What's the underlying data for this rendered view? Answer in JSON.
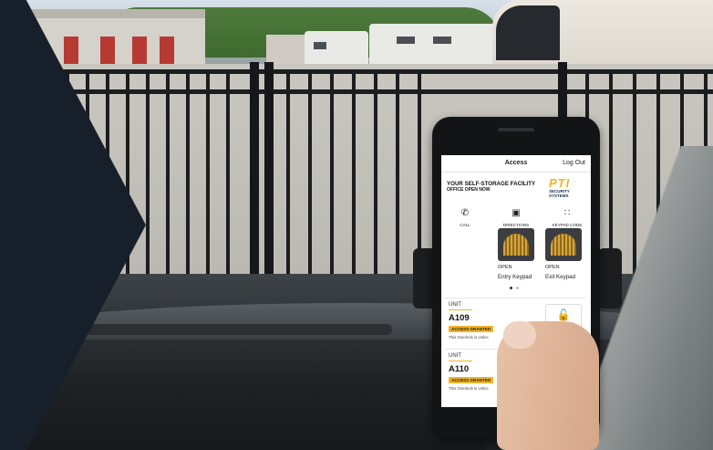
{
  "app": {
    "screen_title": "Access",
    "logout_label": "Log Out",
    "facility_name": "YOUR SELF-STORAGE FACILITY",
    "office_status": "OFFICE OPEN NOW",
    "logo": {
      "brand": "PTI",
      "subtitle_line1": "SECURITY",
      "subtitle_line2": "SYSTEMS"
    }
  },
  "actions": [
    {
      "label": "CALL",
      "icon": "phone-icon"
    },
    {
      "label": "DIRECTIONS",
      "icon": "map-icon"
    },
    {
      "label": "KEYPAD CODE",
      "icon": "keypad-grid-icon"
    }
  ],
  "gates": [
    {
      "status": "OPEN",
      "name": "Entry Keypad",
      "icon": "gate-icon"
    },
    {
      "status": "OPEN",
      "name": "Exit Keypad",
      "icon": "gate-icon"
    }
  ],
  "pagination": {
    "pages": 2,
    "current": 1
  },
  "units": [
    {
      "label": "UNIT",
      "number": "A109",
      "badge": "ACCESS GRANTED",
      "description": "This Overlock is Unloc",
      "lock_status": "UNLOCKED",
      "lock_icon": "unlocked-padlock-icon"
    },
    {
      "label": "UNIT",
      "number": "A110",
      "badge": "ACCESS GRANTED",
      "description": "This Overlock is Unloc",
      "lock_status": "UNLOCKED",
      "lock_icon": "unlocked-padlock-icon"
    }
  ],
  "colors": {
    "accent": "#f0b429",
    "brand_navy": "#1b2a4a",
    "overlay": "#17202a"
  }
}
